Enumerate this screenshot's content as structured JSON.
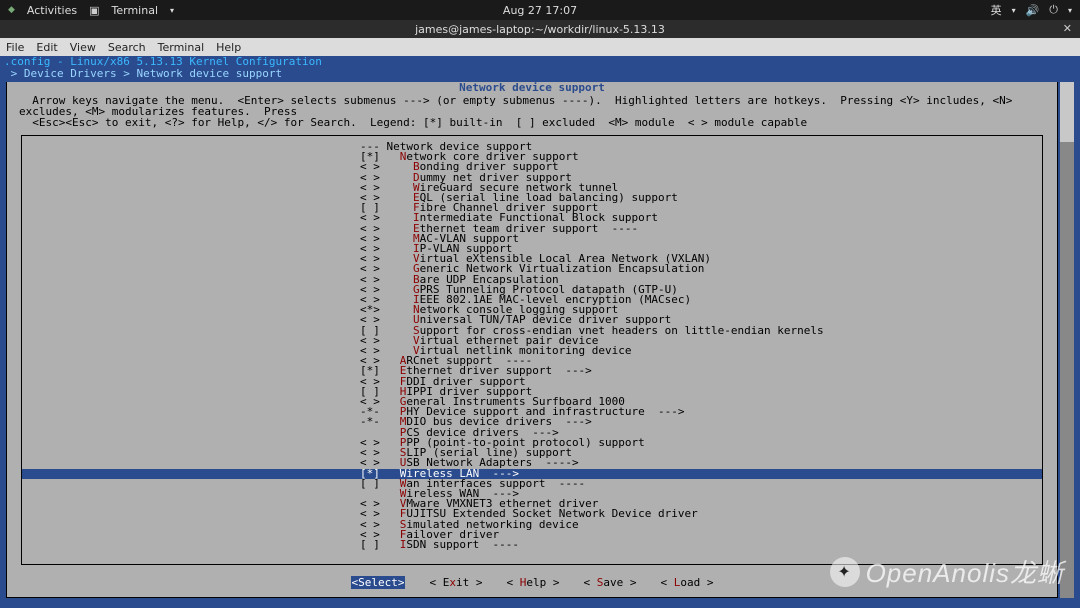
{
  "topbar": {
    "activities": "Activities",
    "terminal": "Terminal",
    "clock": "Aug 27  17:07",
    "ime": "英"
  },
  "titlebar": {
    "text": "james@james-laptop:~/workdir/linux-5.13.13"
  },
  "menubar": {
    "file": "File",
    "edit": "Edit",
    "view": "View",
    "search": "Search",
    "terminal": "Terminal",
    "help": "Help"
  },
  "headline": ".config - Linux/x86 5.13.13 Kernel Configuration",
  "breadcrumb": " > Device Drivers > Network device support ",
  "boxtitle": "Network device support",
  "instructions": "  Arrow keys navigate the menu.  <Enter> selects submenus ---> (or empty submenus ----).  Highlighted letters are hotkeys.  Pressing <Y> includes, <N> excludes, <M> modularizes features.  Press\n  <Esc><Esc> to exit, <?> for Help, </> for Search.  Legend: [*] built-in  [ ] excluded  <M> module  < > module capable",
  "items": [
    {
      "prefix": "--- ",
      "hot": "",
      "label": "Network device support",
      "indent": 0
    },
    {
      "prefix": "[*]   ",
      "hot": "N",
      "label": "etwork core driver support",
      "indent": 0
    },
    {
      "prefix": "< >     ",
      "hot": "B",
      "label": "onding driver support",
      "indent": 0
    },
    {
      "prefix": "< >     ",
      "hot": "D",
      "label": "ummy net driver support",
      "indent": 0
    },
    {
      "prefix": "< >     ",
      "hot": "W",
      "label": "ireGuard secure network tunnel",
      "indent": 0
    },
    {
      "prefix": "< >     ",
      "hot": "E",
      "label": "QL (serial line load balancing) support",
      "indent": 0
    },
    {
      "prefix": "[ ]     ",
      "hot": "F",
      "label": "ibre Channel driver support",
      "indent": 0
    },
    {
      "prefix": "< >     ",
      "hot": "I",
      "label": "ntermediate Functional Block support",
      "indent": 0
    },
    {
      "prefix": "< >     ",
      "hot": "E",
      "label": "thernet team driver support  ----",
      "indent": 0
    },
    {
      "prefix": "< >     ",
      "hot": "M",
      "label": "AC-VLAN support",
      "indent": 0
    },
    {
      "prefix": "< >     ",
      "hot": "I",
      "label": "P-VLAN support",
      "indent": 0
    },
    {
      "prefix": "< >     ",
      "hot": "V",
      "label": "irtual eXtensible Local Area Network (VXLAN)",
      "indent": 0
    },
    {
      "prefix": "< >     ",
      "hot": "G",
      "label": "eneric Network Virtualization Encapsulation",
      "indent": 0
    },
    {
      "prefix": "< >     ",
      "hot": "B",
      "label": "are UDP Encapsulation",
      "indent": 0
    },
    {
      "prefix": "< >     ",
      "hot": "G",
      "label": "PRS Tunneling Protocol datapath (GTP-U)",
      "indent": 0
    },
    {
      "prefix": "< >     ",
      "hot": "I",
      "label": "EEE 802.1AE MAC-level encryption (MACsec)",
      "indent": 0
    },
    {
      "prefix": "<*>     ",
      "hot": "N",
      "label": "etwork console logging support",
      "indent": 0
    },
    {
      "prefix": "< >     ",
      "hot": "U",
      "label": "niversal TUN/TAP device driver support",
      "indent": 0
    },
    {
      "prefix": "[ ]     ",
      "hot": "S",
      "label": "upport for cross-endian vnet headers on little-endian kernels",
      "indent": 0
    },
    {
      "prefix": "< >     ",
      "hot": "V",
      "label": "irtual ethernet pair device",
      "indent": 0
    },
    {
      "prefix": "< >     ",
      "hot": "V",
      "label": "irtual netlink monitoring device",
      "indent": 0
    },
    {
      "prefix": "< >   ",
      "hot": "A",
      "label": "RCnet support  ----",
      "indent": 0
    },
    {
      "prefix": "[*]   ",
      "hot": "E",
      "label": "thernet driver support  --->",
      "indent": 0
    },
    {
      "prefix": "< >   ",
      "hot": "F",
      "label": "DDI driver support",
      "indent": 0
    },
    {
      "prefix": "[ ]   ",
      "hot": "H",
      "label": "IPPI driver support",
      "indent": 0
    },
    {
      "prefix": "< >   ",
      "hot": "G",
      "label": "eneral Instruments Surfboard 1000",
      "indent": 0
    },
    {
      "prefix": "-*-   ",
      "hot": "P",
      "label": "HY Device support and infrastructure  --->",
      "indent": 0
    },
    {
      "prefix": "-*-   ",
      "hot": "M",
      "label": "DIO bus device drivers  --->",
      "indent": 0
    },
    {
      "prefix": "      ",
      "hot": "P",
      "label": "CS device drivers  --->",
      "indent": 0
    },
    {
      "prefix": "< >   ",
      "hot": "P",
      "label": "PP (point-to-point protocol) support",
      "indent": 0
    },
    {
      "prefix": "< >   ",
      "hot": "S",
      "label": "LIP (serial line) support",
      "indent": 0
    },
    {
      "prefix": "< >   ",
      "hot": "U",
      "label": "SB Network Adapters  ---->",
      "indent": 0
    },
    {
      "prefix": "[*]   ",
      "hot": "W",
      "label": "ireless LAN  --->",
      "indent": 0,
      "selected": true
    },
    {
      "prefix": "[ ]   ",
      "hot": "W",
      "label": "an interfaces support  ----",
      "indent": 0
    },
    {
      "prefix": "      ",
      "hot": "W",
      "label": "ireless WAN  --->",
      "indent": 0
    },
    {
      "prefix": "< >   ",
      "hot": "V",
      "label": "Mware VMXNET3 ethernet driver",
      "indent": 0
    },
    {
      "prefix": "< >   ",
      "hot": "F",
      "label": "UJITSU Extended Socket Network Device driver",
      "indent": 0
    },
    {
      "prefix": "< >   ",
      "hot": "S",
      "label": "imulated networking device",
      "indent": 0
    },
    {
      "prefix": "< >   ",
      "hot": "F",
      "label": "ailover driver",
      "indent": 0
    },
    {
      "prefix": "[ ]   ",
      "hot": "I",
      "label": "SDN support  ----",
      "indent": 0
    }
  ],
  "buttons": {
    "select": "<Select>",
    "exit_pre": "< E",
    "exit_hot": "x",
    "exit_post": "it >",
    "help_pre": "< ",
    "help_hot": "H",
    "help_post": "elp >",
    "save_pre": "< ",
    "save_hot": "S",
    "save_post": "ave >",
    "load_pre": "< ",
    "load_hot": "L",
    "load_post": "oad >"
  },
  "watermark": "OpenAnolis龙蜥"
}
